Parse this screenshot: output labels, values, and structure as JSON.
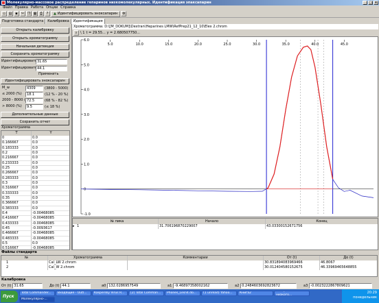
{
  "app": {
    "title": "Молекулярно-массовое распределение гепаринов низкомолекулярных. Идентификация эпаксапарин"
  },
  "menu": [
    "Файл",
    "Правка",
    "Работа",
    "Опции",
    "Справка"
  ],
  "toolbar": {
    "identify_button": "Идентифицировать эноксапарин"
  },
  "tabs": [
    "Подготовка стандарта",
    "Калибровка",
    "Идентификация"
  ],
  "left_panel": {
    "buttons": [
      "Открыть калибровку",
      "Открыть хроматограмму",
      "Начальная детекция",
      "Сохранить хроматограмму"
    ],
    "identify_from_label": "Идентифицировать от",
    "identify_from_value": "31.65",
    "identify_to_label": "Идентифицировать до",
    "identify_to_value": "44.1",
    "apply_button": "Применить",
    "identify_button": "Идентифицировать эноксапарин",
    "stats": [
      {
        "label": "M_w",
        "value": "4309",
        "range": "(3800 - 5000)"
      },
      {
        "label": "≤ 2000 (%)",
        "value": "18.1",
        "range": "(12 % - 20 %)"
      },
      {
        "label": "2000 - 8000 (%)",
        "value": "72.5",
        "range": "(68 % - 82 %)"
      },
      {
        "label": "> 8000 (%)",
        "value": "9.5",
        "range": "(≤ 18 %)"
      }
    ],
    "extra_button": "Дополнительные данные",
    "save_result_button": "Сохранить отчет",
    "chrom_table_label": "Хроматограмма",
    "chrom_table_header": [
      "T",
      "Y"
    ],
    "chrom_rows": [
      [
        "0",
        "0.0"
      ],
      [
        "0.166667",
        "0.0"
      ],
      [
        "0.183333",
        "0.0"
      ],
      [
        "0.2",
        "0.0"
      ],
      [
        "0.216667",
        "0.0"
      ],
      [
        "0.233333",
        "0.0"
      ],
      [
        "0.25",
        "0.0"
      ],
      [
        "0.266667",
        "0.0"
      ],
      [
        "0.283333",
        "0.0"
      ],
      [
        "0.3",
        "0.0"
      ],
      [
        "0.316667",
        "0.0"
      ],
      [
        "0.333333",
        "0.0"
      ],
      [
        "0.35",
        "0.0"
      ],
      [
        "0.366667",
        "0.0"
      ],
      [
        "0.383333",
        "0.0"
      ],
      [
        "0.4",
        "-0.00468085"
      ],
      [
        "0.416667",
        "-0.00468085"
      ],
      [
        "0.433333",
        "-0.00468085"
      ],
      [
        "0.45",
        "-0.0093617"
      ],
      [
        "0.466667",
        "-0.00468085"
      ],
      [
        "0.483333",
        "-0.00468085"
      ],
      [
        "0.5",
        "0.0"
      ],
      [
        "0.516667",
        "-0.00468085"
      ],
      [
        "0.533333",
        "-0.00468085"
      ]
    ]
  },
  "chart_panel": {
    "path_label": "Хроматограмма: D:\\[M_DOKUM]\\Dextran\\Heparines LMW\\RefPrep21_12_10\\Elex 2.chrom",
    "zoom_label": "\\ 1",
    "cursor_label": "t = 29.55...  y = 2.680507750...",
    "peaks_header": [
      "№ пика",
      "Начало",
      "Конец"
    ],
    "peaks_rows": [
      [
        "1",
        "31.706196870229007",
        "43.03300152671756"
      ]
    ]
  },
  "chart_data": {
    "type": "line",
    "xlim": [
      0,
      50
    ],
    "ylim": [
      -1.0,
      6.0
    ],
    "xticks": [
      5.0,
      10.0,
      15.0,
      20.0,
      25.0,
      30.0,
      35.0,
      40.0,
      45.0
    ],
    "yticks": [
      6.0,
      5.0,
      4.0,
      3.0,
      2.0,
      1.0,
      0,
      -1.0
    ],
    "series": [
      {
        "color": "#2020c0",
        "x": [
          0,
          5,
          10,
          15,
          20,
          25,
          29,
          31,
          32,
          33,
          34,
          35,
          36,
          37,
          38,
          38.7,
          39.3,
          40,
          41,
          42,
          43,
          44,
          45,
          46,
          48,
          50
        ],
        "y": [
          0,
          -0.02,
          -0.03,
          -0.05,
          -0.07,
          -0.09,
          -0.1,
          -0.09,
          0.05,
          0.6,
          1.7,
          3.2,
          4.5,
          5.35,
          5.7,
          5.75,
          5.6,
          4.9,
          3.4,
          1.7,
          0.4,
          0.05,
          -0.1,
          -0.05,
          -0.28,
          -0.35
        ]
      },
      {
        "color": "#e02020",
        "x": [
          31.7,
          32,
          33,
          34,
          35,
          36,
          37,
          38,
          38.7,
          39.3,
          40,
          41,
          42,
          43.03
        ],
        "y": [
          0,
          0.05,
          0.6,
          1.7,
          3.2,
          4.5,
          5.35,
          5.7,
          5.75,
          5.6,
          4.9,
          3.4,
          1.7,
          0.4
        ]
      }
    ],
    "vertical_lines_blue": [
      31.7,
      43.03
    ],
    "vertical_lines_gray": [
      37.5,
      40.5,
      41.5
    ]
  },
  "standards": {
    "label": "Файлы стандарта",
    "header": [
      "№",
      "Хроматограмма",
      "Комментарии",
      "От (t)",
      "До (t)"
    ],
    "rows": [
      [
        "1",
        "Cal_LW 2.chrom",
        "",
        "30.831894083969466",
        "46.8067"
      ],
      [
        "2",
        "Cal_W 2.chrom",
        "",
        "30.012404580152675",
        "46.33969465648855"
      ]
    ]
  },
  "calibration": {
    "label": "Калибровка",
    "fields": [
      {
        "label": "От (t)",
        "value": "31.65"
      },
      {
        "label": "До (t)",
        "value": "44.1"
      },
      {
        "label": "a0",
        "value": "132.0286957549"
      },
      {
        "label": "a1",
        "value": "-9.46897358002162"
      },
      {
        "label": "a2",
        "value": "0.2484603692823672"
      },
      {
        "label": "a3",
        "value": "-0.0023222867809621"
      }
    ]
  },
  "taskbar": {
    "start": "Пуск",
    "tasks": [
      "Total Commander...",
      "Входящие - Outl...",
      "Kaspersky Virus R...",
      "[2] Total Comman...",
      "Phones_Lesn4.do...",
      "(1 unread) Yahoo...",
      "Книга2",
      "Гепарины низкого...",
      "Молекулярно-..."
    ],
    "time": "20:29",
    "day": "понедельник"
  }
}
